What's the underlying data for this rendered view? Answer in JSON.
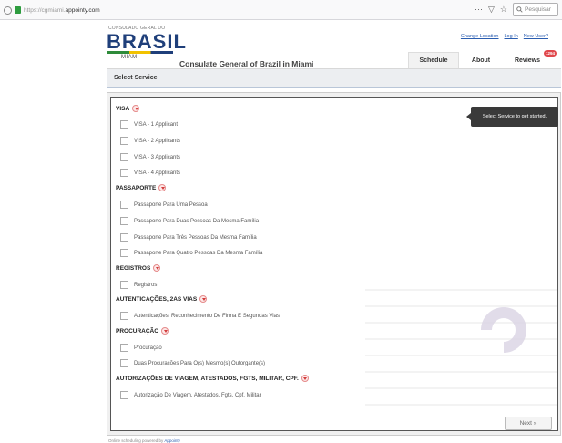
{
  "browser": {
    "url_prefix": "https://cgmiami.",
    "url_domain": "appointy.com",
    "search_placeholder": "Pesquisar",
    "menu_glyph": "⋯",
    "pocket_glyph": "▽",
    "star_glyph": "☆"
  },
  "header": {
    "logo_small": "CONSULADO GERAL DO",
    "logo_main": "BRASIL",
    "logo_city": "MIAMI",
    "title": "Consulate General of Brazil in Miami",
    "links": [
      "Change Location",
      "Log In",
      "New User?"
    ]
  },
  "tabs": {
    "schedule": "Schedule",
    "about": "About",
    "reviews": "Reviews",
    "reviews_badge": "1294"
  },
  "section": {
    "title": "Select Service"
  },
  "tooltip": "Select Service to get started.",
  "categories": [
    {
      "label": "VISA",
      "items": [
        "VISA - 1 Applicant",
        "VISA - 2 Applicants",
        "VISA - 3 Applicants",
        "VISA - 4 Applicants"
      ]
    },
    {
      "label": "PASSAPORTE",
      "items": [
        "Passaporte Para Uma Pessoa",
        "Passaporte Para Duas Pessoas Da Mesma Família",
        "Passaporte Para Três Pessoas Da Mesma Família",
        "Passaporte Para Quatro Pessoas Da Mesma Família"
      ]
    },
    {
      "label": "REGISTROS",
      "items": [
        "Registros"
      ]
    },
    {
      "label": "AUTENTICAÇÕES, 2AS VIAS",
      "items": [
        "Autenticações, Reconhecimento De Firma E Segundas Vias"
      ]
    },
    {
      "label": "PROCURAÇÃO",
      "items": [
        "Procuração",
        "Duas Procurações Para O(s) Mesmo(s) Outorgante(s)"
      ]
    },
    {
      "label": "AUTORIZAÇÕES DE VIAGEM, ATESTADOS, FGTS, MILITAR, CPF.",
      "items": [
        "Autorização De Viagem, Atestados, Fgts, Cpf, Militar"
      ]
    }
  ],
  "buttons": {
    "next": "Next »"
  },
  "footer": {
    "text": "Online scheduling powered by",
    "link": "Appointy"
  }
}
